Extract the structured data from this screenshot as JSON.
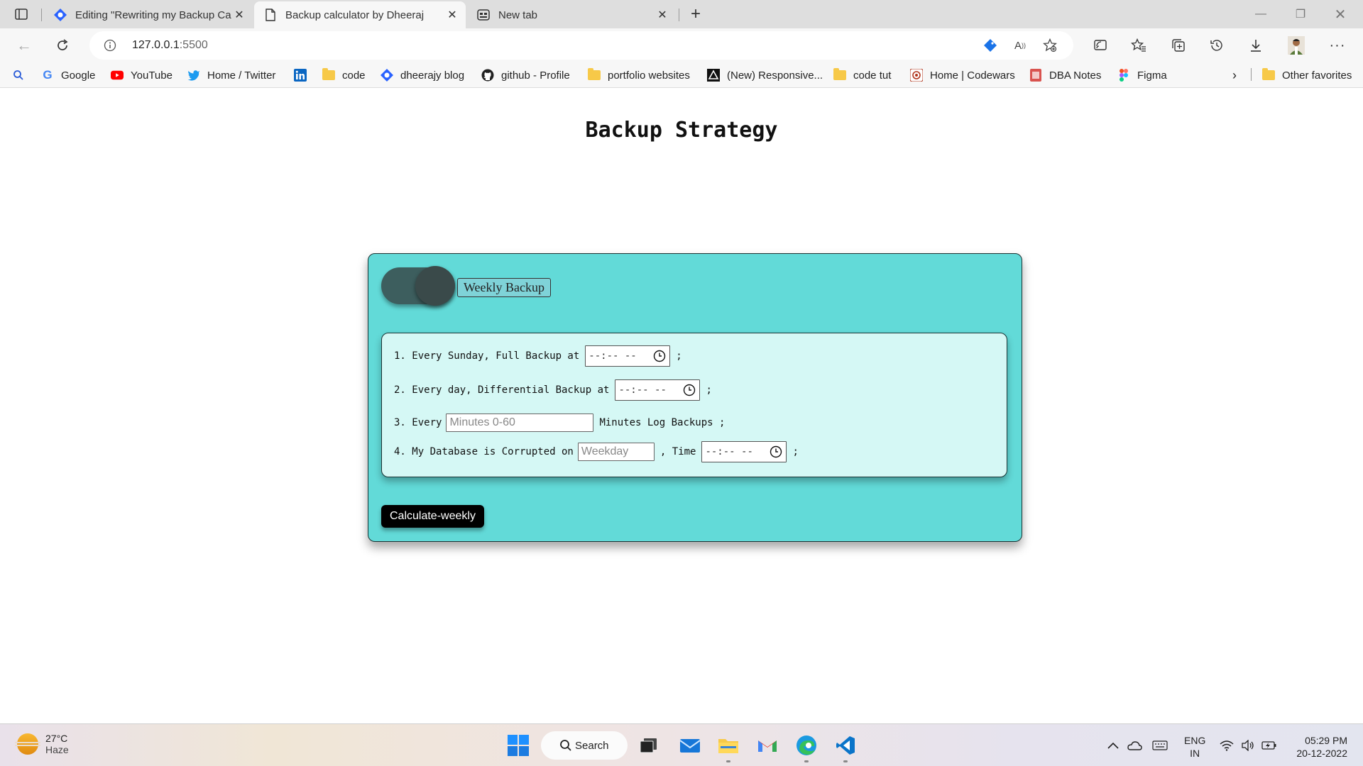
{
  "browser": {
    "tabs": [
      {
        "title": "Editing \"Rewriting my Backup Ca",
        "active": false
      },
      {
        "title": "Backup calculator by Dheeraj",
        "active": true
      },
      {
        "title": "New tab",
        "active": false
      }
    ],
    "address": {
      "host": "127.0.0.1",
      "port": ":5500"
    },
    "favorites": [
      {
        "label": "Google",
        "icon": "google-icon"
      },
      {
        "label": "YouTube",
        "icon": "youtube-icon"
      },
      {
        "label": "Home / Twitter",
        "icon": "twitter-icon"
      },
      {
        "label": "",
        "icon": "linkedin-icon"
      },
      {
        "label": "code",
        "icon": "folder-icon"
      },
      {
        "label": "dheerajy blog",
        "icon": "blog-icon"
      },
      {
        "label": "github - Profile",
        "icon": "github-icon"
      },
      {
        "label": "portfolio websites",
        "icon": "folder-icon"
      },
      {
        "label": "(New) Responsive...",
        "icon": "responsive-icon"
      },
      {
        "label": "code tut",
        "icon": "folder-icon"
      },
      {
        "label": "Home | Codewars",
        "icon": "codewars-icon"
      },
      {
        "label": "DBA Notes",
        "icon": "notes-icon"
      },
      {
        "label": "Figma",
        "icon": "figma-icon"
      }
    ],
    "other_favorites": "Other favorites"
  },
  "page": {
    "title": "Backup Strategy",
    "mode_label": "Weekly Backup",
    "toggle_on": true,
    "rows": {
      "r1_prefix": "1. Every Sunday, Full Backup at",
      "r1_time": "--:-- --",
      "r1_suffix": ";",
      "r2_prefix": "2. Every day, Differential Backup at",
      "r2_time": "--:-- --",
      "r2_suffix": ";",
      "r3_prefix": "3. Every",
      "r3_placeholder": "Minutes 0-60",
      "r3_suffix": "Minutes Log Backups ;",
      "r4_prefix": "4. My Database is Corrupted on",
      "r4_placeholder": "Weekday",
      "r4_mid": ", Time",
      "r4_time": "--:-- --",
      "r4_suffix": ";"
    },
    "calculate_label": "Calculate-weekly",
    "colors": {
      "card": "#62dad8",
      "inner": "#d5f8f5",
      "button": "#000000"
    }
  },
  "taskbar": {
    "temp": "27°C",
    "condition": "Haze",
    "search_label": "Search",
    "lang1": "ENG",
    "lang2": "IN",
    "time": "05:29 PM",
    "date": "20-12-2022"
  }
}
